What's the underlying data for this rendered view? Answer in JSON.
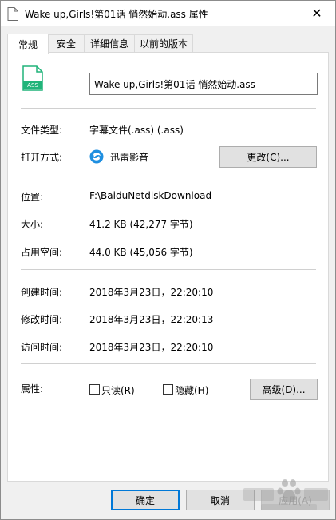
{
  "window": {
    "title": "Wake up,Girls!第01话 悄然始动.ass 属性",
    "close_glyph": "✕"
  },
  "tabs": [
    {
      "label": "常规",
      "active": true
    },
    {
      "label": "安全",
      "active": false
    },
    {
      "label": "详细信息",
      "active": false
    },
    {
      "label": "以前的版本",
      "active": false
    }
  ],
  "file": {
    "icon_text": "ASS",
    "name_value": "Wake up,Girls!第01话 悄然始动.ass"
  },
  "type_section": {
    "file_type_label": "文件类型:",
    "file_type_value": "字幕文件(.ass) (.ass)",
    "open_with_label": "打开方式:",
    "open_with_value": "迅雷影音",
    "change_button": "更改(C)..."
  },
  "location_section": {
    "location_label": "位置:",
    "location_value": "F:\\BaiduNetdiskDownload",
    "size_label": "大小:",
    "size_value": "41.2 KB (42,277 字节)",
    "disk_size_label": "占用空间:",
    "disk_size_value": "44.0 KB (45,056 字节)"
  },
  "time_section": {
    "created_label": "创建时间:",
    "created_value": "2018年3月23日，22:20:10",
    "modified_label": "修改时间:",
    "modified_value": "2018年3月23日，22:20:13",
    "accessed_label": "访问时间:",
    "accessed_value": "2018年3月23日，22:20:10"
  },
  "attributes": {
    "label": "属性:",
    "readonly_label": "只读(R)",
    "readonly_checked": false,
    "hidden_label": "隐藏(H)",
    "hidden_checked": false,
    "advanced_button": "高级(D)..."
  },
  "footer": {
    "ok_button": "确定",
    "cancel_button": "取消",
    "apply_button": "应用(A)"
  },
  "colors": {
    "file_icon": "#21b47a",
    "accent": "#0078d7"
  }
}
